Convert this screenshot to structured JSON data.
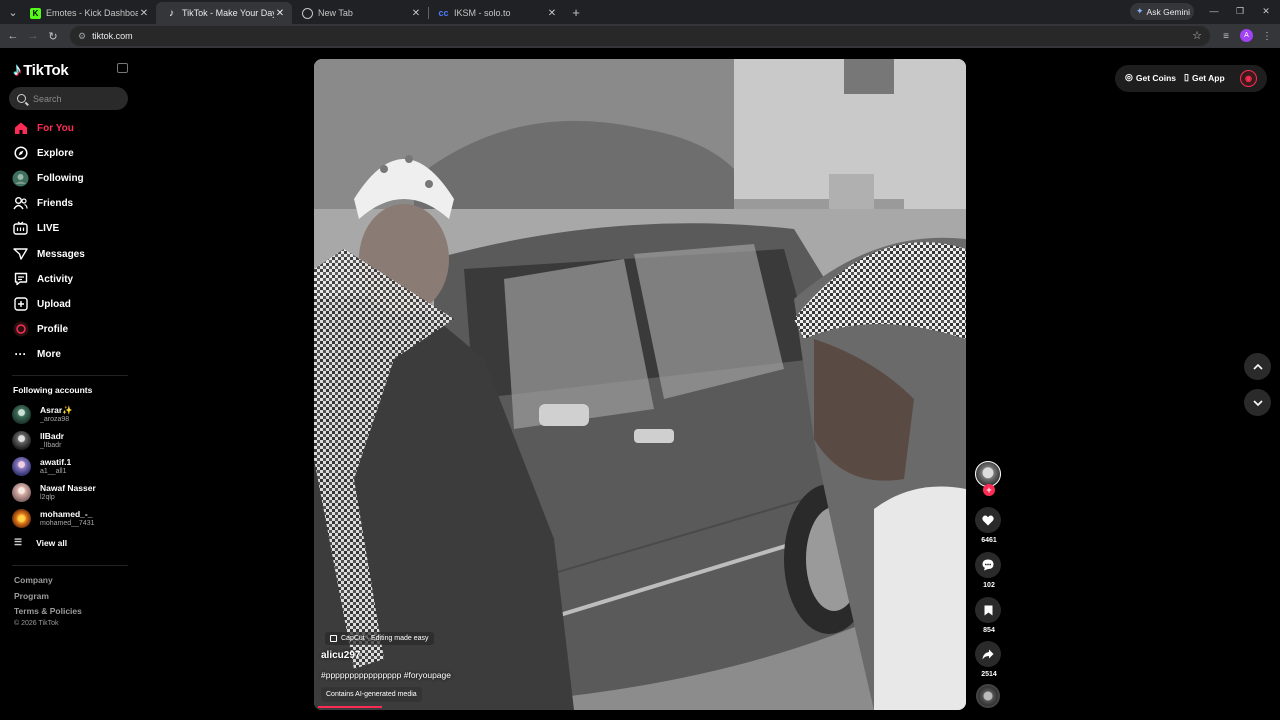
{
  "browser": {
    "tabs": [
      {
        "title": "Emotes - Kick Dashboard",
        "favicon": "kick-icon",
        "color": "#53fc18"
      },
      {
        "title": "TikTok - Make Your Day",
        "favicon": "tiktok-icon",
        "color": "#ffffff"
      },
      {
        "title": "New Tab",
        "favicon": "chrome-icon",
        "color": "#c4c7c5"
      },
      {
        "title": "IKSM - solo.to",
        "favicon": "solo-icon",
        "color": "#4f7cff"
      }
    ],
    "gemini_label": "Ask Gemini",
    "url": "tiktok.com",
    "profile_initial": "A"
  },
  "sidebar": {
    "logo": "TikTok",
    "search_placeholder": "Search",
    "nav": [
      {
        "label": "For You",
        "icon": "home-icon",
        "active": true
      },
      {
        "label": "Explore",
        "icon": "compass-icon"
      },
      {
        "label": "Following",
        "icon": "following-avatar-icon"
      },
      {
        "label": "Friends",
        "icon": "friends-icon"
      },
      {
        "label": "LIVE",
        "icon": "live-icon"
      },
      {
        "label": "Messages",
        "icon": "messages-icon"
      },
      {
        "label": "Activity",
        "icon": "activity-icon"
      },
      {
        "label": "Upload",
        "icon": "upload-icon"
      },
      {
        "label": "Profile",
        "icon": "profile-avatar-icon"
      },
      {
        "label": "More",
        "icon": "more-icon"
      }
    ],
    "following_title": "Following accounts",
    "accounts": [
      {
        "name": "Asrar✨",
        "handle": "_aroza98"
      },
      {
        "name": "lIBadr",
        "handle": "_lIbadr"
      },
      {
        "name": "awatif.1",
        "handle": "a1__all1"
      },
      {
        "name": "Nawaf Nasser",
        "handle": "l2qlp"
      },
      {
        "name": "mohamed_-_",
        "handle": "mohamed__7431"
      }
    ],
    "view_all": "View all",
    "footer": [
      "Company",
      "Program",
      "Terms & Policies"
    ],
    "copyright": "© 2026 TikTok"
  },
  "video": {
    "capcut_label": "CapCut · Editing made easy",
    "author": "alicu297",
    "caption": "#pppppppppppppppp #foryoupage",
    "ai_badge": "Contains AI-generated media",
    "progress": 0.1
  },
  "actions": {
    "likes": "6461",
    "comments": "102",
    "saves": "854",
    "shares": "2514"
  },
  "topbar": {
    "get_coins": "Get Coins",
    "get_app": "Get App"
  },
  "colors": {
    "accent": "#fe2c55",
    "background": "#000000"
  }
}
